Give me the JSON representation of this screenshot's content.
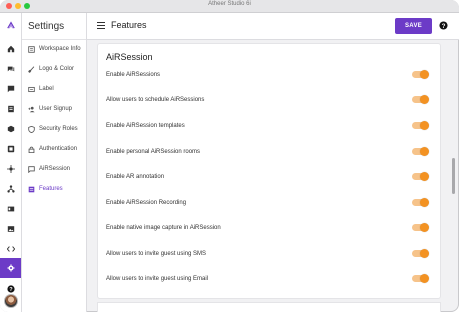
{
  "window": {
    "app_title": "Atheer Studio 6i"
  },
  "rail": {
    "items": [
      {
        "icon": "logo-icon"
      },
      {
        "icon": "home-icon"
      },
      {
        "icon": "chat-icon"
      },
      {
        "icon": "message-icon"
      },
      {
        "icon": "document-icon"
      },
      {
        "icon": "box-icon"
      },
      {
        "icon": "grid-icon"
      },
      {
        "icon": "crosshair-icon"
      },
      {
        "icon": "hierarchy-icon"
      },
      {
        "icon": "id-card-icon"
      },
      {
        "icon": "image-icon"
      },
      {
        "icon": "code-icon"
      },
      {
        "icon": "settings-icon",
        "active": true
      },
      {
        "icon": "help-icon"
      }
    ]
  },
  "settings": {
    "title": "Settings",
    "items": [
      {
        "label": "Workspace Info",
        "icon": "workspace-icon"
      },
      {
        "label": "Logo & Color",
        "icon": "brush-icon"
      },
      {
        "label": "Label",
        "icon": "label-icon"
      },
      {
        "label": "User Signup",
        "icon": "user-add-icon"
      },
      {
        "label": "Security Roles",
        "icon": "shield-icon"
      },
      {
        "label": "Authentication",
        "icon": "lock-icon"
      },
      {
        "label": "AiRSession",
        "icon": "session-icon"
      },
      {
        "label": "Features",
        "icon": "features-icon",
        "active": true
      }
    ]
  },
  "header": {
    "title": "Features",
    "save_label": "SAVE"
  },
  "section": {
    "title": "AiRSession",
    "rows": [
      {
        "label": "Enable AiRSessions",
        "enabled": true
      },
      {
        "label": "Allow users to schedule AiRSessions",
        "enabled": true
      },
      {
        "label": "Enable AiRSession templates",
        "enabled": true
      },
      {
        "label": "Enable personal AiRSession rooms",
        "enabled": true
      },
      {
        "label": "Enable AR annotation",
        "enabled": true
      },
      {
        "label": "Enable AiRSession Recording",
        "enabled": true
      },
      {
        "label": "Enable native image capture in AiRSession",
        "enabled": true
      },
      {
        "label": "Allow users to invite guest using SMS",
        "enabled": true
      },
      {
        "label": "Allow users to invite guest using Email",
        "enabled": true
      }
    ]
  },
  "colors": {
    "accent": "#6c3bc7",
    "toggle_on": "#f39222",
    "toggle_track": "#f6c38a"
  }
}
